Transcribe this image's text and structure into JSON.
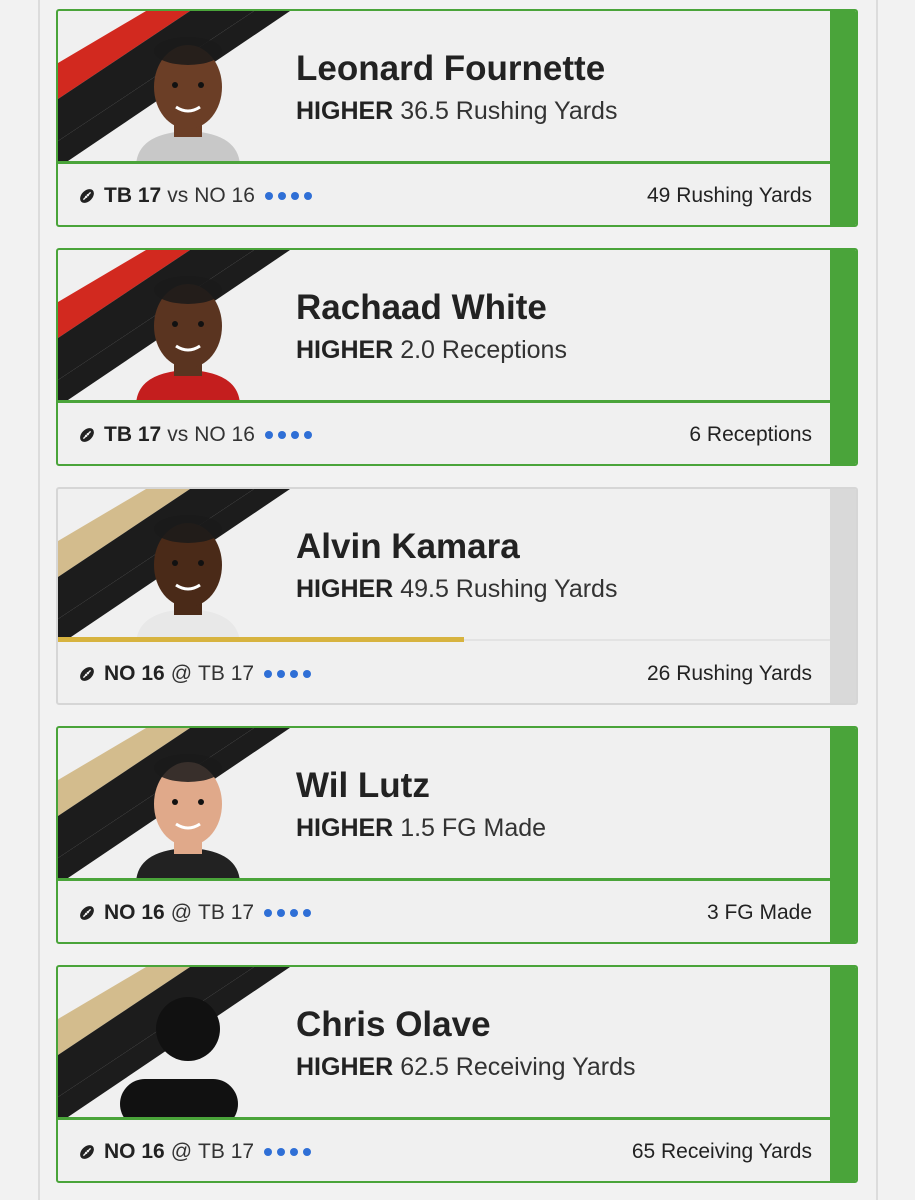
{
  "colors": {
    "won": "#4aa43a",
    "pending": "#d9d9d9",
    "bucs_red": "#d2291f",
    "saints_gold": "#d3bc8d",
    "stripe_black": "#1c1c1c",
    "dot_blue": "#2f6fd6",
    "progress_gold": "#d7b33f"
  },
  "picks": [
    {
      "player": "Leonard Fournette",
      "direction": "HIGHER",
      "line": "36.5 Rushing Yards",
      "team": "TB 17",
      "connector": "vs",
      "opponent": "NO 16",
      "result": "49 Rushing Yards",
      "status": "won",
      "team_color": "bucs_red",
      "avatar": "player-headshot"
    },
    {
      "player": "Rachaad White",
      "direction": "HIGHER",
      "line": "2.0 Receptions",
      "team": "TB 17",
      "connector": "vs",
      "opponent": "NO 16",
      "result": "6 Receptions",
      "status": "won",
      "team_color": "bucs_red",
      "avatar": "player-headshot"
    },
    {
      "player": "Alvin Kamara",
      "direction": "HIGHER",
      "line": "49.5 Rushing Yards",
      "team": "NO 16",
      "connector": "@",
      "opponent": "TB 17",
      "result": "26 Rushing Yards",
      "status": "pending",
      "progress": 0.525,
      "team_color": "saints_gold",
      "avatar": "player-headshot"
    },
    {
      "player": "Wil Lutz",
      "direction": "HIGHER",
      "line": "1.5 FG Made",
      "team": "NO 16",
      "connector": "@",
      "opponent": "TB 17",
      "result": "3 FG Made",
      "status": "won",
      "team_color": "saints_gold",
      "avatar": "player-headshot"
    },
    {
      "player": "Chris Olave",
      "direction": "HIGHER",
      "line": "62.5 Receiving Yards",
      "team": "NO 16",
      "connector": "@",
      "opponent": "TB 17",
      "result": "65 Receiving Yards",
      "status": "won",
      "team_color": "saints_gold",
      "avatar": "placeholder-silhouette"
    }
  ]
}
